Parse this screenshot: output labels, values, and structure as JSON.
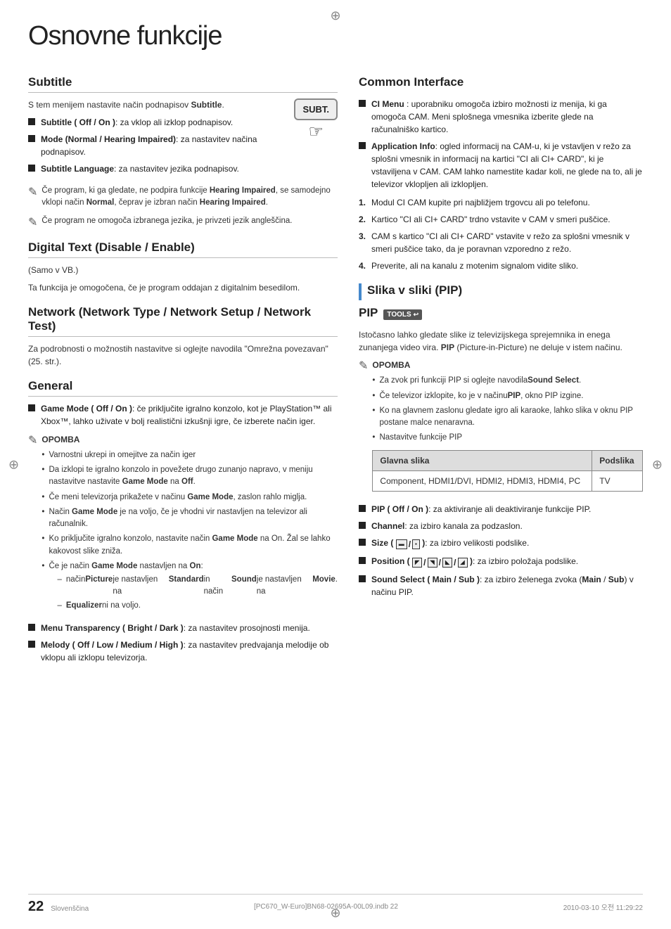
{
  "page": {
    "title": "Osnovne funkcije",
    "language": "Slovenščina",
    "page_number": "22",
    "footer_file": "[PC670_W-Euro]BN68-02695A-00L09.indb  22",
    "footer_date": "2010-03-10   오전 11:29:22"
  },
  "left_col": {
    "subtitle_section": {
      "title": "Subtitle",
      "intro": "S tem menijem nastavite način podnapisov Subtitle.",
      "subt_button_label": "SUBT.",
      "items": [
        {
          "label": "Subtitle ( Off / On )",
          "text": ": za vklop ali izklop podnapisov."
        },
        {
          "label": "Mode (Normal / Hearing Impaired)",
          "text": ": za nastavitev načina podnapisov."
        },
        {
          "label": "Subtitle Language",
          "text": ": za nastavitev jezika podnapisov."
        }
      ],
      "notes": [
        "Če program, ki ga gledate, ne podpira funkcije Hearing Impaired, se samodejno vklopi način Normal, čeprav je izbran način Hearing Impaired.",
        "Če program ne omogoča izbranega jezika, je privzeti jezik angleščina."
      ]
    },
    "digital_text_section": {
      "title": "Digital Text (Disable / Enable)",
      "subtitle": "(Samo v VB.)",
      "text": "Ta funkcija je omogočena, če je program oddajan z digitalnim besedilom."
    },
    "network_section": {
      "title": "Network (Network Type / Network Setup / Network Test)",
      "text": "Za podrobnosti o možnostih nastavitve si oglejte navodila \"Omrežna povezavan\" (25. str.)."
    },
    "general_section": {
      "title": "General",
      "items": [
        {
          "label": "Game Mode ( Off / On )",
          "text": ": če priključite igralno konzolo, kot je PlayStation™ ali Xbox™, lahko uživate v bolj realistični izkušnji igre, če izberete način iger."
        }
      ],
      "opomba_title": "OPOMBA",
      "opomba_bullets": [
        "Varnostni ukrepi in omejitve za način iger",
        "Da izklopi te igralno konzolo in povežete drugo zunanjo napravo, v meniju nastavitve nastavite Game Mode na Off.",
        "Če meni televizorja prikažete v načinu Game Mode, zaslon rahlo miglja.",
        "Način Game Mode je na voljo, če je vhodni vir nastavljen na televizor ali računalnik.",
        "Ko priključite igralno konzolo, nastavite način Game Mode na On. Žal se lahko kakovost slike zniža.",
        "Če je način Game Mode nastavljen na On:"
      ],
      "opomba_sub_bullets": [
        "– način Picture je nastavljen na Standard in način Sound je nastavljen na Movie.",
        "– Equalizer ni na voljo."
      ],
      "items2": [
        {
          "label": "Menu Transparency ( Bright / Dark )",
          "text": ": za nastavitev prosojnosti menija."
        },
        {
          "label": "Melody ( Off / Low / Medium / High )",
          "text": ": za nastavitev predvajanja melodije ob vklopu ali izklopu televizorja."
        }
      ]
    }
  },
  "right_col": {
    "common_interface_section": {
      "title": "Common Interface",
      "items": [
        {
          "label": "CI Menu",
          "text": ":  uporabniku omogoča izbiro možnosti iz menija, ki ga omogoča CAM. Meni splošnega vmesnika izberite glede na računalniško kartico."
        },
        {
          "label": "Application Info",
          "text": ": ogled informacij na CAM-u, ki je vstavljen v režo za splošni vmesnik in informacij na kartici \"CI ali CI+ CARD\", ki je vstaviljena v CAM. CAM lahko namestite kadar koli, ne glede na to, ali je televizor vklopljen ali izklopljen."
        }
      ],
      "ordered": [
        "Modul CI CAM kupite pri najbližjem trgovcu ali po telefonu.",
        "Kartico \"CI ali CI+ CARD\" trdno vstavite v CAM v smeri puščice.",
        "CAM s kartico \"CI ali CI+ CARD\" vstavite v režo za splošni vmesnik v smeri puščice tako, da je poravnan vzporedno z režo.",
        "Preverite, ali na kanalu z motenim signalom vidite sliko."
      ]
    },
    "slika_section": {
      "title": "Slika v sliki (PIP)"
    },
    "pip_section": {
      "title": "PIP",
      "tools_badge": "TOOLS",
      "intro": "Istočasno lahko gledate slike iz televizijskega sprejemnika in enega zunanjega video vira. PIP (Picture-in-Picture) ne deluje v istem načinu.",
      "opomba_title": "OPOMBA",
      "opomba_bullets": [
        "Za zvok pri funkciji PIP si oglejte navodila Sound Select.",
        "Če televizor izklopite, ko je v načinu PIP, okno PIP izgine.",
        "Ko na glavnem zaslonu gledate igro ali karaoke, lahko slika v oknu PIP postane malce nenaravna.",
        "Nastavitve funkcije PIP"
      ],
      "table": {
        "headers": [
          "Glavna slika",
          "Podslika"
        ],
        "rows": [
          [
            "Component, HDMI1/DVI, HDMI2, HDMI3, HDMI4, PC",
            "TV"
          ]
        ]
      },
      "items": [
        {
          "label": "PIP ( Off / On )",
          "text": ": za aktiviranje ali deaktiviranje funkcije PIP."
        },
        {
          "label": "Channel",
          "text": ": za izbiro kanala za podzaslon."
        },
        {
          "label": "Size ( □ / □ )",
          "text": ": za izbiro velikosti podslike.",
          "has_icons": true
        },
        {
          "label": "Position ( □ / □ / □ / □ )",
          "text": ": za izbiro položaja podslike.",
          "has_icons": true
        },
        {
          "label": "Sound Select ( Main / Sub )",
          "text": ": za izbiro želenega zvoka (Main / Sub) v načinu PIP."
        }
      ]
    }
  }
}
